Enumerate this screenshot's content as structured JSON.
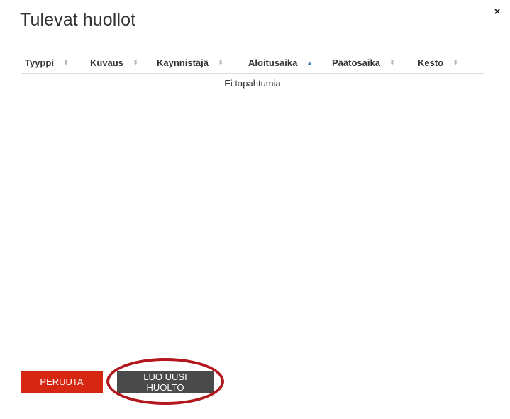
{
  "dialog": {
    "title": "Tulevat huollot",
    "close_icon": "×"
  },
  "table": {
    "columns": [
      {
        "label": "Tyyppi",
        "sort": "none"
      },
      {
        "label": "Kuvaus",
        "sort": "none"
      },
      {
        "label": "Käynnistäjä",
        "sort": "none"
      },
      {
        "label": "Aloitusaika",
        "sort": "ascending"
      },
      {
        "label": "Päätösaika",
        "sort": "none"
      },
      {
        "label": "Kesto",
        "sort": "none"
      }
    ],
    "empty_message": "Ei tapahtumia"
  },
  "footer": {
    "cancel_label": "PERUUTA",
    "create_label": "LUO UUSI HUOLTO"
  },
  "colors": {
    "cancel_button": "#d62712",
    "create_button": "#4a4a4a",
    "highlight_ring": "#b3161c",
    "sort_active": "#3a7fc1"
  },
  "icons": {
    "sort_none": "sort-both-icon",
    "sort_asc": "sort-ascending-icon",
    "close": "close-icon"
  }
}
